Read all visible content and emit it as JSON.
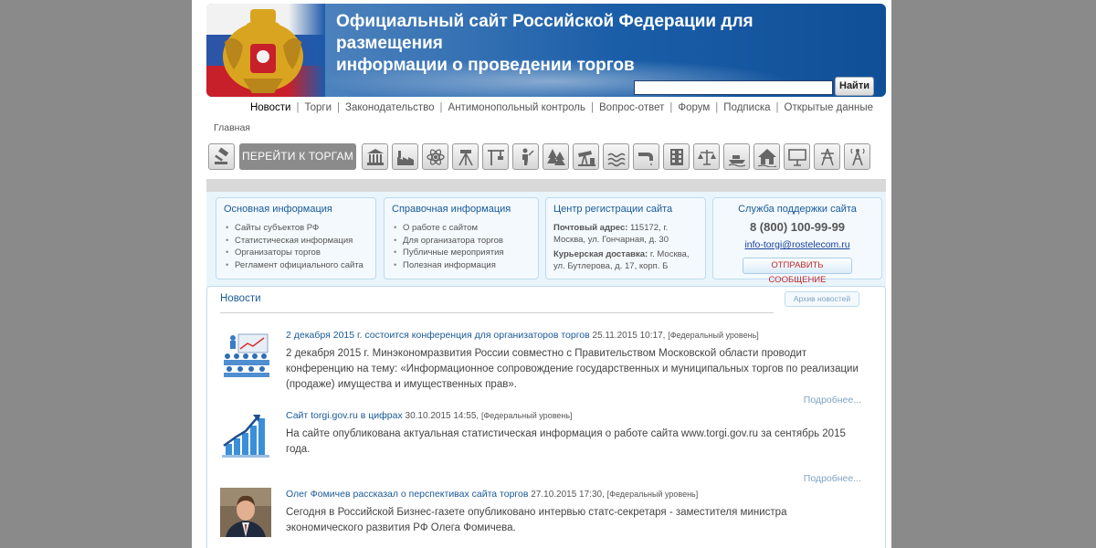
{
  "header": {
    "title_line1": "Официальный сайт Российской Федерации для размещения",
    "title_line2": "информации о проведении торгов",
    "search_value": "",
    "search_button": "Найти"
  },
  "topnav": {
    "items": [
      "Новости",
      "Торги",
      "Законодательство",
      "Антимонопольный контроль",
      "Вопрос-ответ",
      "Форум",
      "Подписка",
      "Открытые данные"
    ],
    "separator": "|"
  },
  "breadcrumb": "Главная",
  "category_bar": {
    "go_button": "ПЕРЕЙТИ К ТОРГАМ",
    "icons": [
      "auction-icon",
      "building-columns-icon",
      "factory-icon",
      "atom-icon",
      "survey-tripod-icon",
      "construction-crane-icon",
      "hunter-icon",
      "forest-icon",
      "oil-pump-icon",
      "water-waves-icon",
      "water-pipe-icon",
      "apartment-building-icon",
      "scales-icon",
      "boat-icon",
      "house-icon",
      "billboard-icon",
      "power-line-icon",
      "radio-tower-icon"
    ]
  },
  "info": {
    "basic": {
      "title": "Основная информация",
      "items": [
        "Сайты субъектов РФ",
        "Статистическая информация",
        "Организаторы торгов",
        "Регламент официального сайта"
      ]
    },
    "reference": {
      "title": "Справочная информация",
      "items": [
        "О работе с сайтом",
        "Для организатора торгов",
        "Публичные мероприятия",
        "Полезная информация"
      ]
    },
    "registration": {
      "title": "Центр регистрации сайта",
      "postal_label": "Почтовый адрес:",
      "postal_value": "115172, г. Москва, ул. Гончарная, д. 30",
      "courier_label": "Курьерская доставка:",
      "courier_value": "г. Москва, ул. Бутлерова, д. 17, корп. Б"
    },
    "support": {
      "title": "Служба поддержки сайта",
      "phone": "8 (800) 100-99-99",
      "email": "info-torgi@rostelecom.ru",
      "button": "ОТПРАВИТЬ СООБЩЕНИЕ"
    }
  },
  "news": {
    "title": "Новости",
    "archive_button": "Архив новостей",
    "items": [
      {
        "headline": "2 декабря 2015 г. состоится конференция для организаторов торгов",
        "date": "25.11.2015 10:17,",
        "level": "[Федеральный уровень]",
        "text": "2 декабря 2015 г. Минэкономразвития России совместно с Правительством Московской области проводит конференцию на тему: «Информационное сопровождение государственных и муниципальных торгов по реализации (продаже) имущества и имущественных прав».",
        "more": "Подробнее..."
      },
      {
        "headline": "Сайт torgi.gov.ru в цифрах",
        "date": "30.10.2015 14:55,",
        "level": "[Федеральный уровень]",
        "text": "На сайте опубликована актуальная статистическая информация о работе сайта www.torgi.gov.ru за сентябрь 2015 года.",
        "more": "Подробнее..."
      },
      {
        "headline": "Олег Фомичев рассказал о перспективах сайта торгов",
        "date": "27.10.2015 17:30,",
        "level": "[Федеральный уровень]",
        "text": "Сегодня в Российской Бизнес-газете опубликовано интервью статс-секретаря - заместителя министра экономического развития РФ Олега Фомичева.",
        "more": ""
      }
    ]
  },
  "colors": {
    "link": "#1a5a99",
    "banner": "#1b5ea8",
    "alert_red": "#c0282d"
  }
}
